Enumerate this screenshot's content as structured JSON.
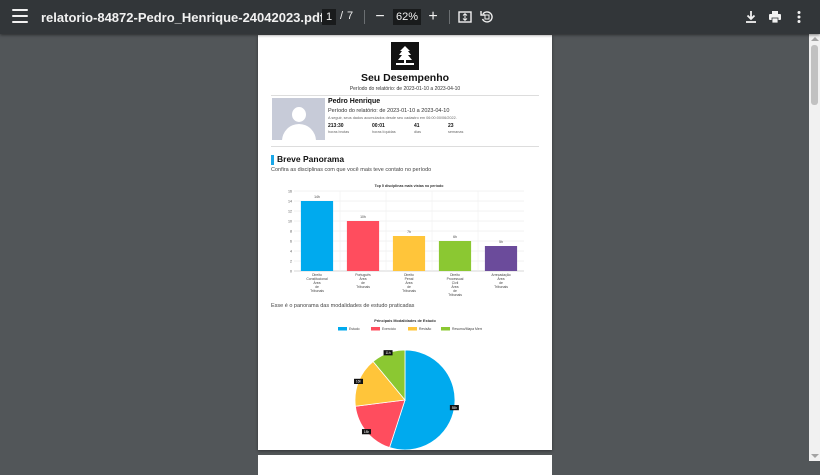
{
  "toolbar": {
    "filename": "relatorio-84872-Pedro_Henrique-24042023.pdf",
    "current_page": "1",
    "page_separator": "/",
    "total_pages": "7",
    "zoom_out": "−",
    "zoom_level": "62%",
    "zoom_in": "+",
    "icons": [
      "menu-icon",
      "fit-page-icon",
      "rotate-icon",
      "download-icon",
      "print-icon",
      "more-vert-icon"
    ]
  },
  "report": {
    "title": "Seu Desempenho",
    "period": "Período do relatório: de 2023-01-10 a 2023-04-10",
    "student": {
      "name": "Pedro Henrique",
      "period": "Período do relatório: de 2023-01-10 a 2023-04-10",
      "note": "A seguir, seus dados acumulados desde seu cadastro em 06:00:00/06/2022.",
      "stats": [
        {
          "value": "213:30",
          "label": "horas brutas"
        },
        {
          "value": "00:01",
          "label": "horas líquidas"
        },
        {
          "value": "41",
          "label": "dias"
        },
        {
          "value": "23",
          "label": "semanas"
        }
      ]
    },
    "section1": {
      "title": "Breve Panorama",
      "subtitle": "Confira as disciplinas com que você mais teve contato no período"
    },
    "section2": {
      "subtitle": "Esse é o panorama das modalidades de estudo praticadas"
    }
  },
  "chart_data": [
    {
      "type": "bar",
      "title": "Top 5 disciplinas mais vistas no período",
      "categories": [
        [
          "Direito",
          "Constitucional",
          "Área",
          "de",
          "Tribunais"
        ],
        [
          "Português",
          "Área",
          "de",
          "Tribunais"
        ],
        [
          "Direito",
          "Penal",
          "Área",
          "de",
          "Tribunais"
        ],
        [
          "Direito",
          "Processual",
          "Civil",
          "Área",
          "de",
          "Tribunais"
        ],
        [
          "Arrecadação",
          "Área",
          "de",
          "Tribunais"
        ]
      ],
      "values": [
        14,
        10,
        7,
        6,
        5
      ],
      "value_labels": [
        "14h",
        "10h",
        "7h",
        "6h",
        "5h"
      ],
      "colors": [
        "#00aaee",
        "#ff4d5e",
        "#ffc53a",
        "#8bc832",
        "#6b4b9b"
      ],
      "ylim": [
        0,
        16
      ],
      "yticks": [
        0,
        2,
        4,
        6,
        8,
        10,
        12,
        14,
        16
      ],
      "grid": true
    },
    {
      "type": "pie",
      "title": "Principais Modalidades de Estudo",
      "legend": [
        "Estudo",
        "Exercício",
        "Revisão",
        "Resumo/Mapa Mental"
      ],
      "values": [
        55,
        18,
        16,
        11
      ],
      "value_labels": [
        "55h",
        "18h",
        "16h",
        "11h"
      ],
      "colors": [
        "#00aaee",
        "#ff4d5e",
        "#ffc53a",
        "#8bc832"
      ],
      "legend_position": "top"
    }
  ]
}
